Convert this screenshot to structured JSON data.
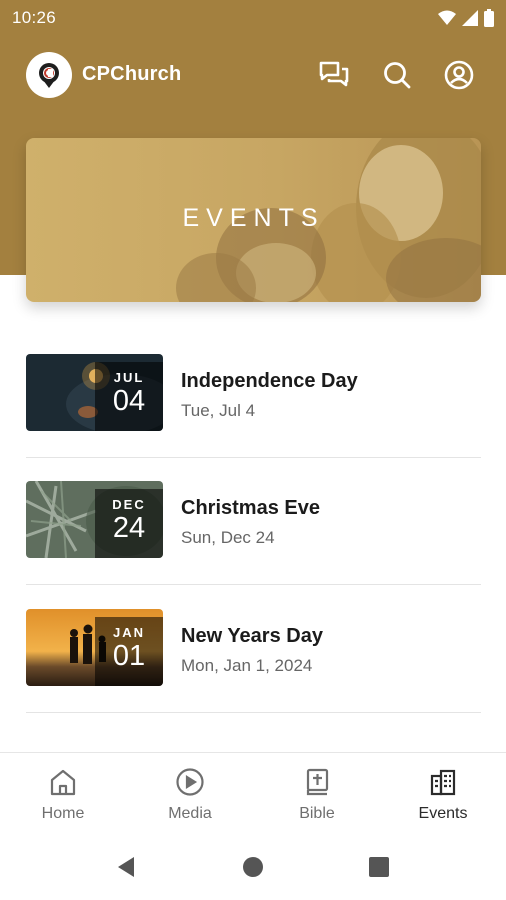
{
  "status_bar": {
    "time": "10:26"
  },
  "app": {
    "name": "CPChurch"
  },
  "header_icons": [
    "chat-icon",
    "search-icon",
    "account-icon"
  ],
  "hero": {
    "title": "EVENTS"
  },
  "events": [
    {
      "title": "Independence Day",
      "date": "Tue, Jul 4",
      "month": "JUL",
      "day": "04"
    },
    {
      "title": "Christmas Eve",
      "date": "Sun, Dec 24",
      "month": "DEC",
      "day": "24"
    },
    {
      "title": "New Years Day",
      "date": "Mon, Jan 1, 2024",
      "month": "JAN",
      "day": "01"
    }
  ],
  "bottom_nav": [
    {
      "label": "Home",
      "icon": "home-icon"
    },
    {
      "label": "Media",
      "icon": "play-circle-icon"
    },
    {
      "label": "Bible",
      "icon": "bible-icon"
    },
    {
      "label": "Events",
      "icon": "events-icon",
      "active": true
    }
  ],
  "colors": {
    "brand": "#a3803f",
    "text_primary": "#1b1b1b",
    "text_secondary": "#666666"
  }
}
